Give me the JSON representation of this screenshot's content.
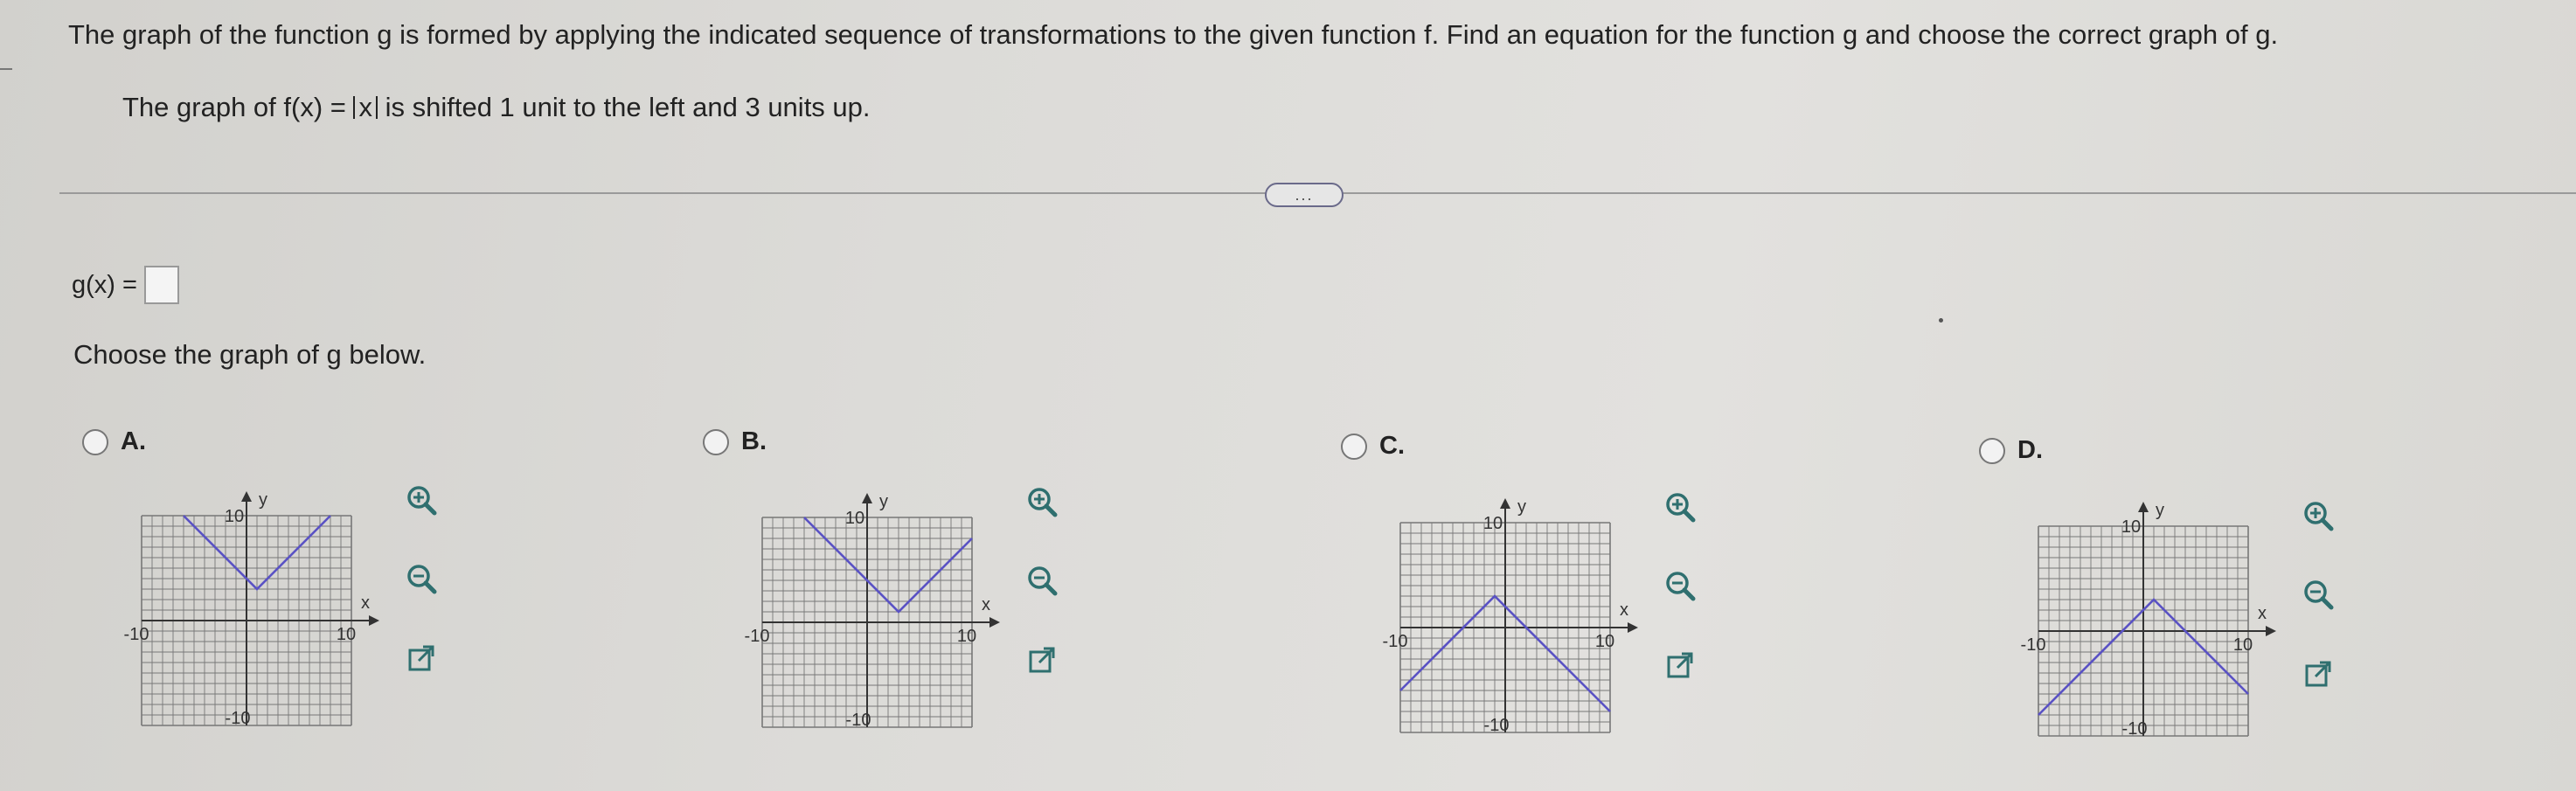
{
  "question": {
    "instruction": "The graph of the function g is formed by applying the indicated sequence of transformations to the given function f. Find an equation for the function g and choose the correct graph of g.",
    "sub_prefix": "The graph of f(x) = ",
    "sub_abs": "x",
    "sub_suffix": " is shifted 1 unit to the left and 3 units up."
  },
  "more_button": "...",
  "answer": {
    "label": "g(x) =",
    "value": ""
  },
  "choose_label": "Choose the graph of g below.",
  "options": [
    {
      "letter": "A.",
      "vertex": [
        1,
        3
      ],
      "direction": "up"
    },
    {
      "letter": "B.",
      "vertex": [
        3,
        1
      ],
      "direction": "up"
    },
    {
      "letter": "C.",
      "vertex": [
        -1,
        3
      ],
      "direction": "down"
    },
    {
      "letter": "D.",
      "vertex": [
        1,
        3
      ],
      "direction": "down"
    }
  ],
  "graph_labels": {
    "x": "x",
    "y": "y",
    "top": "10",
    "left": "-10",
    "right": "10",
    "bottom": "-10"
  },
  "icons": [
    "zoom-in-icon",
    "zoom-out-icon",
    "new-window-icon"
  ],
  "colors": {
    "graph_line": "#5a52c4",
    "grid": "#777777",
    "icon": "#2f6f6f"
  }
}
